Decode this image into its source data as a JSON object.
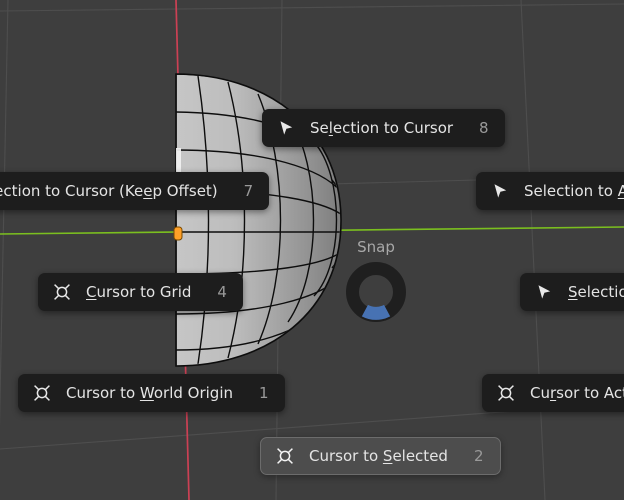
{
  "app": {
    "name": "blender-3d-viewport",
    "editor": "3D Viewport",
    "mode": "Edit Mode"
  },
  "viewport": {
    "background_color": "#3e3e3e",
    "grid_color": "#4f4f4f",
    "axis_x_color": "#cc4054",
    "axis_y_color": "#7bbf1f",
    "object_face_color": "#b4b4b4",
    "object_wire_color": "#101010",
    "active_vertex_color": "#ffa028",
    "object": "uv-sphere"
  },
  "pie_menu": {
    "title": "Snap",
    "ring": {
      "track_color": "#1f1f1f",
      "indicator_color": "#4772b3",
      "indicator_direction": "down"
    },
    "items": [
      {
        "id": "selection-to-cursor",
        "label": "Selection to Cursor",
        "underline_index": 2,
        "key": "8",
        "icon": "cursor-arrow-icon",
        "selected": false,
        "clipped": "none"
      },
      {
        "id": "selection-to-cursor-keep-offset",
        "label": "lection to Cursor (Keep Offset)",
        "full_label": "Selection to Cursor (Keep Offset)",
        "underline_index": 21,
        "key": "7",
        "icon": "cursor-arrow-icon",
        "selected": false,
        "clipped": "left"
      },
      {
        "id": "selection-to-active",
        "label": "Selection to A",
        "full_label": "Selection to Active",
        "underline_index": 13,
        "key": "",
        "icon": "cursor-arrow-icon",
        "selected": false,
        "clipped": "right"
      },
      {
        "id": "cursor-to-grid",
        "label": "Cursor to Grid",
        "underline_index": 0,
        "key": "4",
        "icon": "cursor-3d-icon",
        "selected": false,
        "clipped": "none"
      },
      {
        "id": "selection-to-grid",
        "label": "Selectio",
        "full_label": "Selection to Grid",
        "underline_index": 0,
        "key": "",
        "icon": "cursor-arrow-icon",
        "selected": false,
        "clipped": "right"
      },
      {
        "id": "cursor-to-world-origin",
        "label": "Cursor to World Origin",
        "underline_index": 10,
        "key": "1",
        "icon": "cursor-3d-icon",
        "selected": false,
        "clipped": "none"
      },
      {
        "id": "cursor-to-active",
        "label": "Cursor to Acti",
        "full_label": "Cursor to Active",
        "underline_index": 2,
        "key": "",
        "icon": "cursor-3d-icon",
        "selected": false,
        "clipped": "right"
      },
      {
        "id": "cursor-to-selected",
        "label": "Cursor to Selected",
        "underline_index": 10,
        "key": "2",
        "icon": "cursor-3d-icon",
        "selected": true,
        "clipped": "none"
      }
    ]
  }
}
